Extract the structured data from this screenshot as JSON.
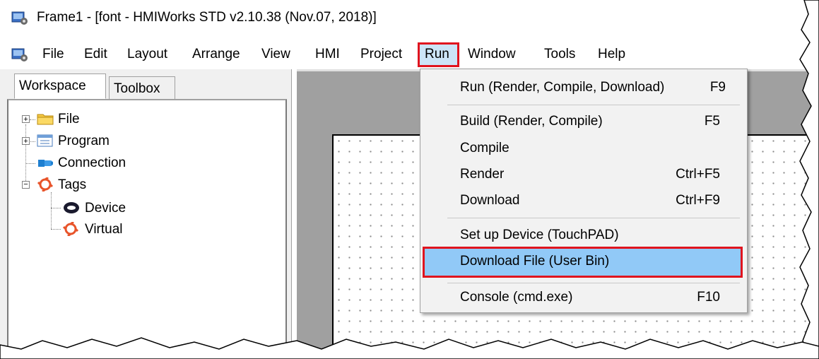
{
  "window": {
    "title": "Frame1 - [font - HMIWorks STD v2.10.38 (Nov.07, 2018)]"
  },
  "menubar": {
    "items": [
      "File",
      "Edit",
      "Layout",
      "Arrange",
      "View",
      "HMI",
      "Project",
      "Run",
      "Window",
      "Tools",
      "Help"
    ],
    "active": "Run"
  },
  "tabs": [
    "Workspace",
    "Toolbox"
  ],
  "tree": {
    "file": "File",
    "program": "Program",
    "connection": "Connection",
    "tags": "Tags",
    "device": "Device",
    "virtual": "Virtual"
  },
  "run_menu": {
    "items": [
      {
        "label": "Run (Render, Compile, Download)",
        "shortcut": "F9"
      },
      {
        "label": "Build (Render, Compile)",
        "shortcut": "F5"
      },
      {
        "label": "Compile",
        "shortcut": ""
      },
      {
        "label": "Render",
        "shortcut": "Ctrl+F5"
      },
      {
        "label": "Download",
        "shortcut": "Ctrl+F9"
      },
      {
        "label": "Set up Device (TouchPAD)",
        "shortcut": ""
      },
      {
        "label": "Download File (User Bin)",
        "shortcut": ""
      },
      {
        "label": "Console (cmd.exe)",
        "shortcut": "F10"
      }
    ],
    "highlighted": "Download File (User Bin)"
  },
  "colors": {
    "annotation_red": "#e0141e",
    "menu_highlight": "#91c9f7",
    "folder_yellow": "#f5c842",
    "tag_orange": "#e8542a",
    "connection_blue": "#1e7fd0"
  },
  "icons": [
    "app-icon",
    "folder-icon",
    "program-icon",
    "connection-icon",
    "tags-icon",
    "device-icon",
    "virtual-tag-icon"
  ]
}
